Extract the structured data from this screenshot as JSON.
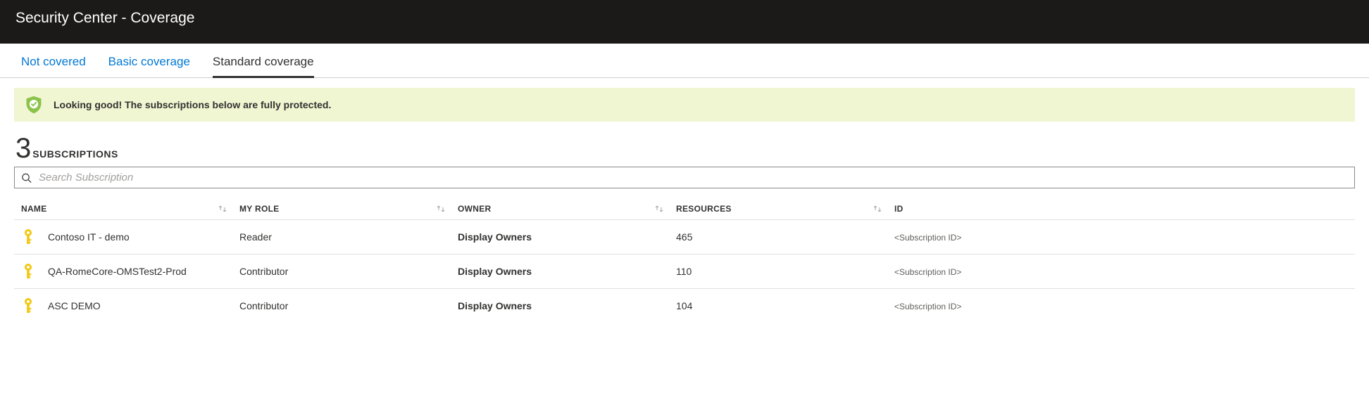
{
  "header": {
    "title": "Security Center - Coverage"
  },
  "tabs": [
    {
      "label": "Not covered",
      "active": false
    },
    {
      "label": "Basic coverage",
      "active": false
    },
    {
      "label": "Standard coverage",
      "active": true
    }
  ],
  "banner": {
    "message": "Looking good! The subscriptions below are fully protected."
  },
  "subscription_count": {
    "number": "3",
    "label": "SUBSCRIPTIONS"
  },
  "search": {
    "placeholder": "Search Subscription"
  },
  "columns": {
    "name": "NAME",
    "role": "MY ROLE",
    "owner": "OWNER",
    "res": "RESOURCES",
    "id": "ID"
  },
  "owner_action": "Display Owners",
  "id_placeholder": "<Subscription ID>",
  "rows": [
    {
      "name": "Contoso IT - demo",
      "role": "Reader",
      "resources": "465"
    },
    {
      "name": "QA-RomeCore-OMSTest2-Prod",
      "role": "Contributor",
      "resources": "110"
    },
    {
      "name": "ASC DEMO",
      "role": "Contributor",
      "resources": "104"
    }
  ]
}
